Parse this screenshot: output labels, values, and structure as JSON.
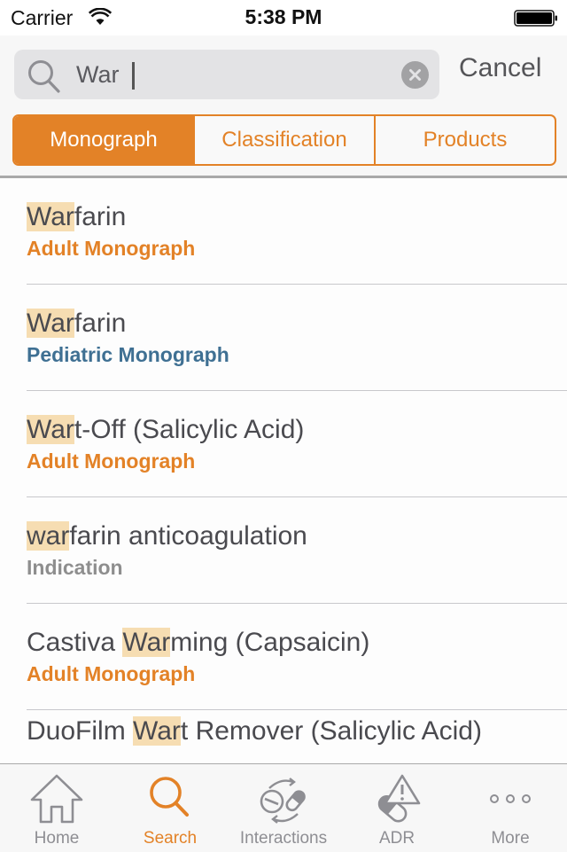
{
  "status_bar": {
    "carrier": "Carrier",
    "time": "5:38 PM",
    "wifi_icon": "wifi-icon",
    "battery_icon": "battery-full-icon",
    "battery_level_percent": 100
  },
  "search": {
    "value": "War",
    "placeholder": "",
    "search_icon": "search-icon",
    "clear_icon": "clear-circle-icon",
    "cancel_label": "Cancel"
  },
  "segments": [
    {
      "label": "Monograph",
      "active": true
    },
    {
      "label": "Classification",
      "active": false
    },
    {
      "label": "Products",
      "active": false
    }
  ],
  "colors": {
    "accent": "#e38227",
    "pediatric": "#3f7093",
    "indication": "#8e8e8e",
    "highlight": "#f6ddb2"
  },
  "results": [
    {
      "prefix": "",
      "match": "War",
      "suffix": "farin",
      "subtitle": "Adult Monograph",
      "subtitle_type": "adult"
    },
    {
      "prefix": "",
      "match": "War",
      "suffix": "farin",
      "subtitle": "Pediatric Monograph",
      "subtitle_type": "pediatric"
    },
    {
      "prefix": "",
      "match": "War",
      "suffix": "t-Off (Salicylic Acid)",
      "subtitle": "Adult Monograph",
      "subtitle_type": "adult"
    },
    {
      "prefix": "",
      "match": "war",
      "suffix": "farin anticoagulation",
      "subtitle": "Indication",
      "subtitle_type": "indication"
    },
    {
      "prefix": "Castiva ",
      "match": "War",
      "suffix": "ming (Capsaicin)",
      "subtitle": "Adult Monograph",
      "subtitle_type": "adult"
    },
    {
      "prefix": "DuoFilm ",
      "match": "War",
      "suffix": "t Remover (Salicylic Acid)",
      "subtitle": "",
      "subtitle_type": "adult"
    }
  ],
  "tab_bar": {
    "items": [
      {
        "label": "Home",
        "icon": "home-icon",
        "active": false
      },
      {
        "label": "Search",
        "icon": "search-icon",
        "active": true
      },
      {
        "label": "Interactions",
        "icon": "interactions-pills-icon",
        "active": false
      },
      {
        "label": "ADR",
        "icon": "adr-warning-pill-icon",
        "active": false
      },
      {
        "label": "More",
        "icon": "more-dots-icon",
        "active": false
      }
    ]
  }
}
